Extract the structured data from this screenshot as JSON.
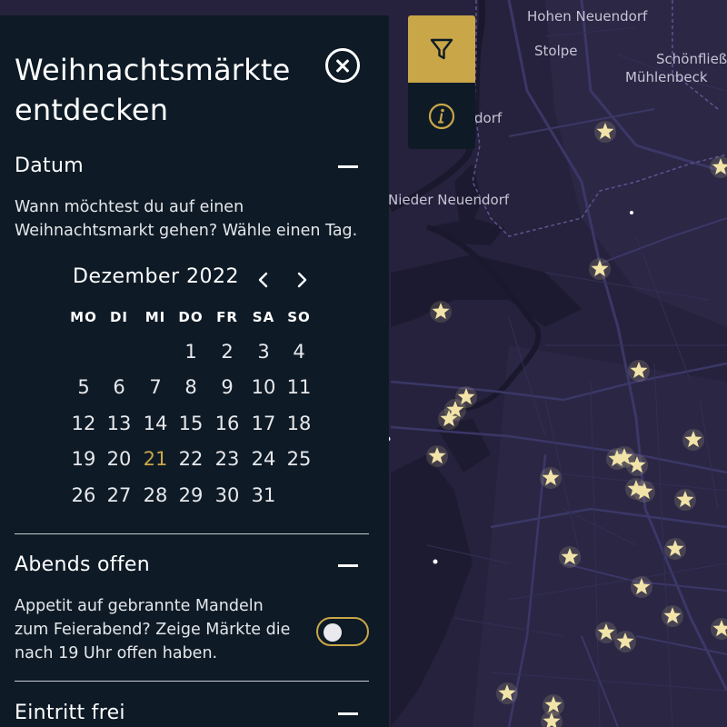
{
  "map": {
    "labels": [
      {
        "text": "Hohen Neuendorf"
      },
      {
        "text": "Stolpe"
      },
      {
        "text": "Schönfließ"
      },
      {
        "text": "Mühlenbeck"
      },
      {
        "text": "dorf"
      },
      {
        "text": "Nieder Neuendorf"
      }
    ],
    "accent_color": "#c9a648",
    "star_color": "#f2e4a8",
    "background_color": "#26223d"
  },
  "map_controls": {
    "filter_icon": "filter-funnel-icon",
    "info_icon": "info-circle-icon"
  },
  "panel": {
    "title_line1": "Weihnachtsmärkte",
    "title_line2": "entdecken",
    "close_icon": "close-circle-icon"
  },
  "sections": {
    "datum": {
      "heading": "Datum",
      "description_line1": "Wann möchtest du auf einen",
      "description_line2": "Weihnachtsmarkt gehen? Wähle einen Tag."
    },
    "abends": {
      "heading": "Abends offen",
      "description_line1": "Appetit auf gebrannte Mandeln",
      "description_line2": "zum Feierabend? Zeige Märkte die",
      "description_line3": "nach 19 Uhr offen haben.",
      "toggle_on": false
    },
    "eintritt": {
      "heading": "Eintritt frei"
    }
  },
  "calendar": {
    "month_label": "Dezember 2022",
    "weekdays": [
      "MO",
      "DI",
      "MI",
      "DO",
      "FR",
      "SA",
      "SO"
    ],
    "weeks": [
      [
        "",
        "",
        "",
        "1",
        "2",
        "3",
        "4"
      ],
      [
        "5",
        "6",
        "7",
        "8",
        "9",
        "10",
        "11"
      ],
      [
        "12",
        "13",
        "14",
        "15",
        "16",
        "17",
        "18"
      ],
      [
        "19",
        "20",
        "21",
        "22",
        "23",
        "24",
        "25"
      ],
      [
        "26",
        "27",
        "28",
        "29",
        "30",
        "31",
        ""
      ]
    ],
    "selected_day": "21"
  }
}
